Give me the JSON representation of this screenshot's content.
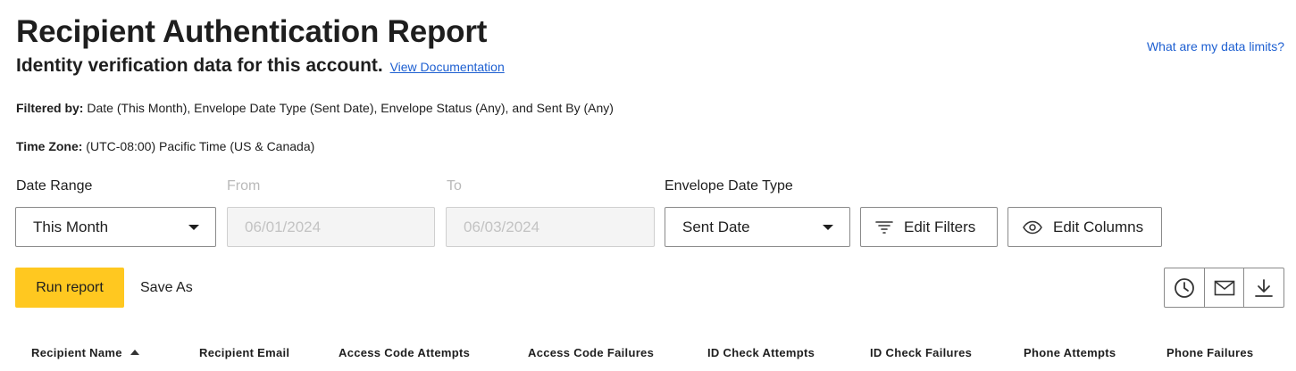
{
  "header": {
    "title": "Recipient Authentication Report",
    "subtitle": "Identity verification data for this account.",
    "doc_link": "View Documentation",
    "limits_link": "What are my data limits?"
  },
  "meta": {
    "filter_label": "Filtered by:",
    "filter_value": " Date (This Month), Envelope Date Type (Sent Date), Envelope Status (Any), and Sent By (Any)",
    "tz_label": "Time Zone:",
    "tz_value": " (UTC-08:00) Pacific Time (US & Canada)"
  },
  "filters": {
    "date_range_label": "Date Range",
    "date_range_value": "This Month",
    "from_label": "From",
    "from_value": "06/01/2024",
    "to_label": "To",
    "to_value": "06/03/2024",
    "envelope_date_type_label": "Envelope Date Type",
    "envelope_date_type_value": "Sent Date",
    "edit_filters": "Edit Filters",
    "edit_columns": "Edit Columns"
  },
  "actions": {
    "run_report": "Run report",
    "save_as": "Save As",
    "icons": [
      "clock-icon",
      "mail-icon",
      "download-icon"
    ]
  },
  "table": {
    "columns": [
      "Recipient Name",
      "Recipient Email",
      "Access Code Attempts",
      "Access Code Failures",
      "ID Check Attempts",
      "ID Check Failures",
      "Phone Attempts",
      "Phone Failures"
    ],
    "sorted_column": "Recipient Name",
    "sort_direction": "ascending"
  },
  "colors": {
    "accent": "#ffc820",
    "link": "#1d5fd1",
    "border": "#8a8a8a",
    "disabled_bg": "#f4f4f4"
  }
}
